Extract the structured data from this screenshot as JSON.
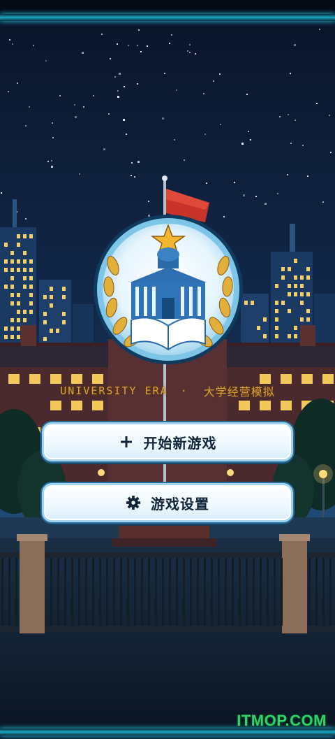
{
  "title": {
    "subtitle_en": "UNIVERSITY ERA",
    "separator": "·",
    "subtitle_cn": "大学经营模拟"
  },
  "menu": {
    "start_label": "开始新游戏",
    "start_icon": "plus-icon",
    "settings_label": "游戏设置",
    "settings_icon": "gear-icon"
  },
  "watermark": "ITMOP.COM",
  "colors": {
    "accent_gold": "#d8a23c",
    "button_text": "#10243a",
    "frame_cyan": "#1aa7c4",
    "watermark_green": "#31d16b"
  }
}
